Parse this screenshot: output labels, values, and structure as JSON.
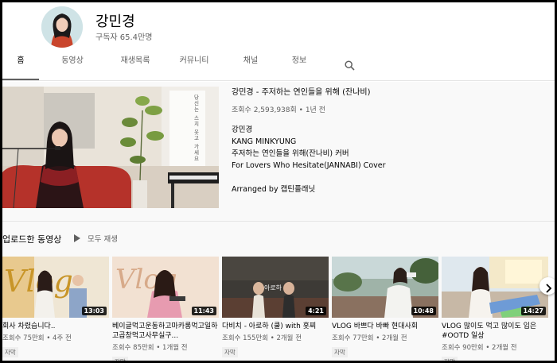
{
  "channel": {
    "name": "강민경",
    "subscribers": "구독자 65.4만명"
  },
  "tabs": [
    "홈",
    "동영상",
    "재생목록",
    "커뮤니티",
    "채널",
    "정보"
  ],
  "featured": {
    "title": "강민경 - 주저하는 연인들을 위해 (잔나비)",
    "meta": "조회수 2,593,938회 • 1년 전",
    "description": [
      "강민경",
      "KANG MINKYUNG",
      "주저하는 연인들을 위해(잔나비) 커버",
      "For Lovers Who Hesitate(JANNABI) Cover"
    ],
    "credit": "Arranged by 캡틴플래닛",
    "thumb_text": "당신는 스치 웃고 가세요"
  },
  "uploads": {
    "title": "업로드한 동영상",
    "play_all": "모두 재생"
  },
  "videos": [
    {
      "title": "회사 차렸습니다..",
      "meta": "조회수 75만회 • 4주 전",
      "badge": "자막",
      "duration": "13:03",
      "thumb_text": "Vlog"
    },
    {
      "title": "베이글먹고운동하고마카롱먹고일하고곱창먹고사무실구...",
      "meta": "조회수 85만회 • 1개월 전",
      "badge": "자막",
      "duration": "11:43",
      "thumb_text": "Vlog"
    },
    {
      "title": "다비치 - 아로하 (쿨) with 훗찌",
      "meta": "조회수 155만회 • 2개월 전",
      "badge": "자막",
      "duration": "4:21",
      "thumb_text": "아로하"
    },
    {
      "title": "VLOG 바쁘다 바빠 현대사회",
      "meta": "조회수 77만회 • 2개월 전",
      "badge": "자막",
      "duration": "10:48",
      "thumb_text": ""
    },
    {
      "title": "VLOG 많이도 먹고 많이도 입은 #OOTD 일상",
      "meta": "조회수 90만회 • 2개월 전",
      "badge": "자막",
      "duration": "14:27",
      "thumb_text": ""
    }
  ],
  "icons": {
    "search": "search-icon",
    "next": "chevron-right-icon",
    "play": "play-icon"
  },
  "colors": {
    "background": "#f9f9f9",
    "header": "#ffffff",
    "text_primary": "#030303",
    "text_secondary": "#606060"
  }
}
